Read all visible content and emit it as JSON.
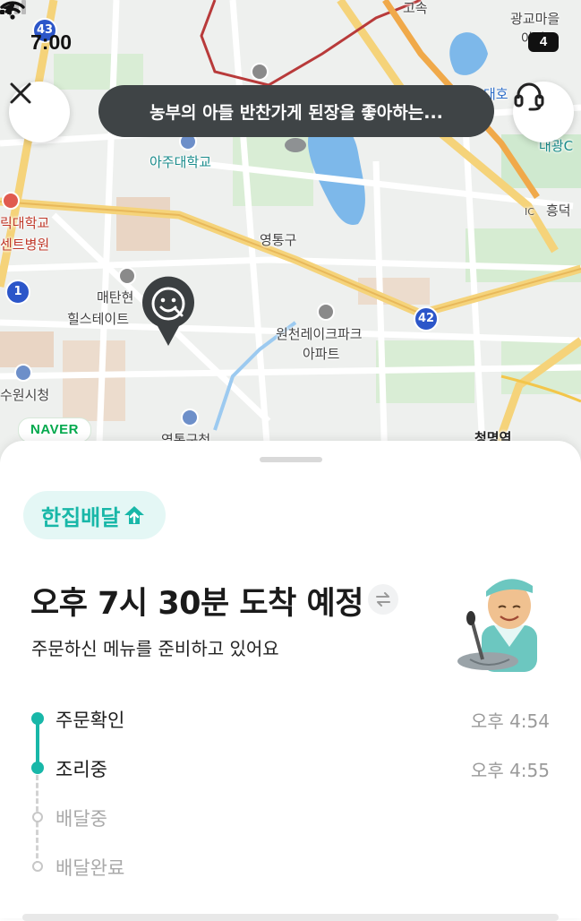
{
  "status_bar": {
    "time": "7:00",
    "battery": "4"
  },
  "map": {
    "tooltip": "농부의 아들 반찬가게 된장을 좋아하는...",
    "provider_logo": "NAVER",
    "labels": {
      "gwanggyo": "광교마을",
      "apt_top": "아파트",
      "highway": "고속",
      "daeho": "대호",
      "daegwang": "대광C",
      "ajou_univ": "아주대학교",
      "hospital_1": "릭대학교",
      "hospital_2": "센트병원",
      "yeongtong_gu": "영통구",
      "heungdeok": "흥덕",
      "maetan_1": "매탄현",
      "maetan_2": "힐스테이트",
      "wonchen_1": "원천레이크파크",
      "wonchen_2": "아파트",
      "suwon_city_hall": "수원시청",
      "cheongmyeong": "청명역",
      "yeongtong_office": "영통구청",
      "ic": "IC"
    },
    "shields": {
      "r43": "43",
      "r1": "1",
      "r42": "42"
    }
  },
  "sheet": {
    "service_badge": "한집배달",
    "eta_title": "오후 7시 30분 도착 예정",
    "eta_subtitle": "주문하신 메뉴를 준비하고 있어요",
    "steps": [
      {
        "label": "주문확인",
        "time": "오후 4:54",
        "status": "done"
      },
      {
        "label": "조리중",
        "time": "오후 4:55",
        "status": "done"
      },
      {
        "label": "배달중",
        "time": "",
        "status": "todo"
      },
      {
        "label": "배달완료",
        "time": "",
        "status": "todo"
      }
    ]
  },
  "colors": {
    "accent": "#18b7a8",
    "badge_bg": "#e4f7f5",
    "tooltip_bg": "#3f4446",
    "naver_green": "#03a94d"
  },
  "icons": [
    "close-icon",
    "headset-icon",
    "location-arrow-icon",
    "wifi-icon",
    "signal-icon",
    "smiley-spoon-icon",
    "house-icon",
    "swap-icon"
  ]
}
